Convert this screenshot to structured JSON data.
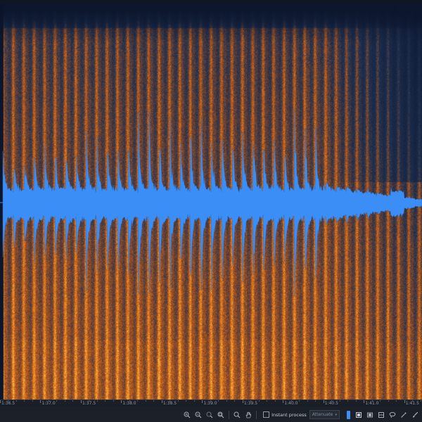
{
  "colors": {
    "spectrogram_hot": "#f08a26",
    "spectrogram_cold": "#0b1a35",
    "waveform": "#3a8ef6",
    "toolbar_bg": "#1b2029",
    "accent": "#3e8df4"
  },
  "timeline": {
    "ticks": [
      {
        "label": "1:36.5",
        "time": 96.5
      },
      {
        "label": "1:37.0",
        "time": 97.0
      },
      {
        "label": "1:37.5",
        "time": 97.5
      },
      {
        "label": "1:38.0",
        "time": 98.0
      },
      {
        "label": "1:38.5",
        "time": 98.5
      },
      {
        "label": "1:39.0",
        "time": 99.0
      },
      {
        "label": "1:39.5",
        "time": 99.5
      },
      {
        "label": "1:40.0",
        "time": 100.0
      },
      {
        "label": "1:40.5",
        "time": 100.5
      },
      {
        "label": "1:41.0",
        "time": 101.0
      },
      {
        "label": "1:41.5",
        "time": 101.5
      }
    ],
    "start_time": 96.5,
    "end_time": 101.72
  },
  "waveform_view": {
    "onset_time": 96.54,
    "decay_time": 100.5
  },
  "toolbar": {
    "icons": [
      "zoom-in-icon",
      "zoom-out-icon",
      "zoom-selection-icon",
      "zoom-fit-icon",
      "magnifier-icon",
      "hand-icon"
    ],
    "instant_process_label": "Instant process",
    "instant_process_checked": false,
    "mode_value": "Attenuate",
    "right_icons": [
      "blue-mode-icon",
      "rect-select-icon",
      "time-select-icon",
      "freq-select-icon",
      "lasso-icon",
      "magic-wand-icon",
      "brush-icon"
    ]
  }
}
